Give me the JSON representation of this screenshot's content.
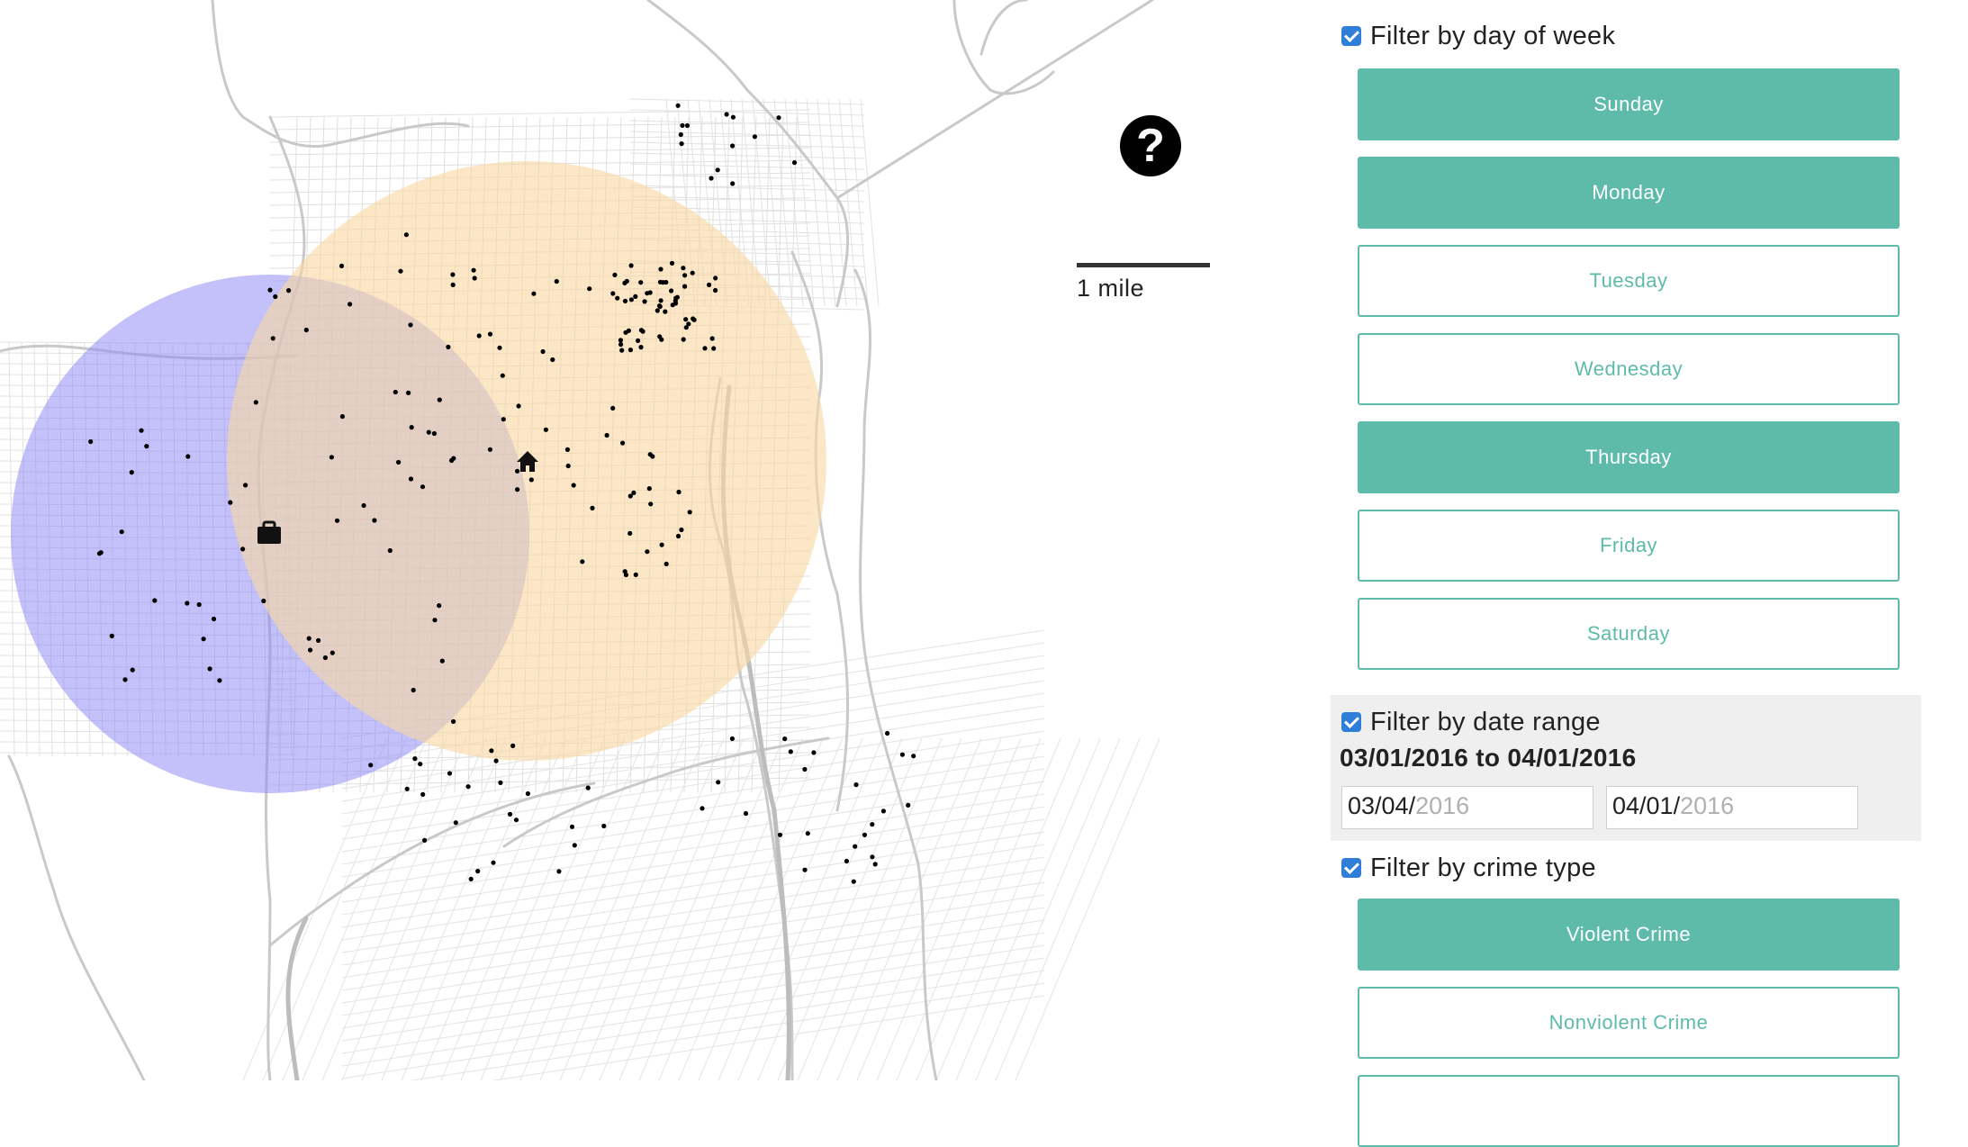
{
  "map": {
    "help_label": "?",
    "scale_label": "1 mile",
    "colors": {
      "circle_blue": "#8c87f5",
      "circle_orange": "#f9d9a3",
      "dots": "#000000",
      "streets": "#d4d4d4"
    },
    "icons": [
      "home-icon",
      "briefcase-icon",
      "help-icon"
    ]
  },
  "panel": {
    "day_filter": {
      "label": "Filter by day of week",
      "checked": true,
      "days": [
        {
          "label": "Sunday",
          "active": true
        },
        {
          "label": "Monday",
          "active": true
        },
        {
          "label": "Tuesday",
          "active": false
        },
        {
          "label": "Wednesday",
          "active": false
        },
        {
          "label": "Thursday",
          "active": true
        },
        {
          "label": "Friday",
          "active": false
        },
        {
          "label": "Saturday",
          "active": false
        }
      ]
    },
    "date_filter": {
      "label": "Filter by date range",
      "checked": true,
      "summary": "03/01/2016 to 04/01/2016",
      "start_md": "03/04/",
      "start_year": "2016",
      "end_md": "04/01/",
      "end_year": "2016"
    },
    "crime_filter": {
      "label": "Filter by crime type",
      "checked": true,
      "types": [
        {
          "label": "Violent Crime",
          "active": true
        },
        {
          "label": "Nonviolent Crime",
          "active": false
        }
      ]
    }
  },
  "colors": {
    "accent": "#5ebbaa",
    "checkbox": "#2f7fd8"
  }
}
